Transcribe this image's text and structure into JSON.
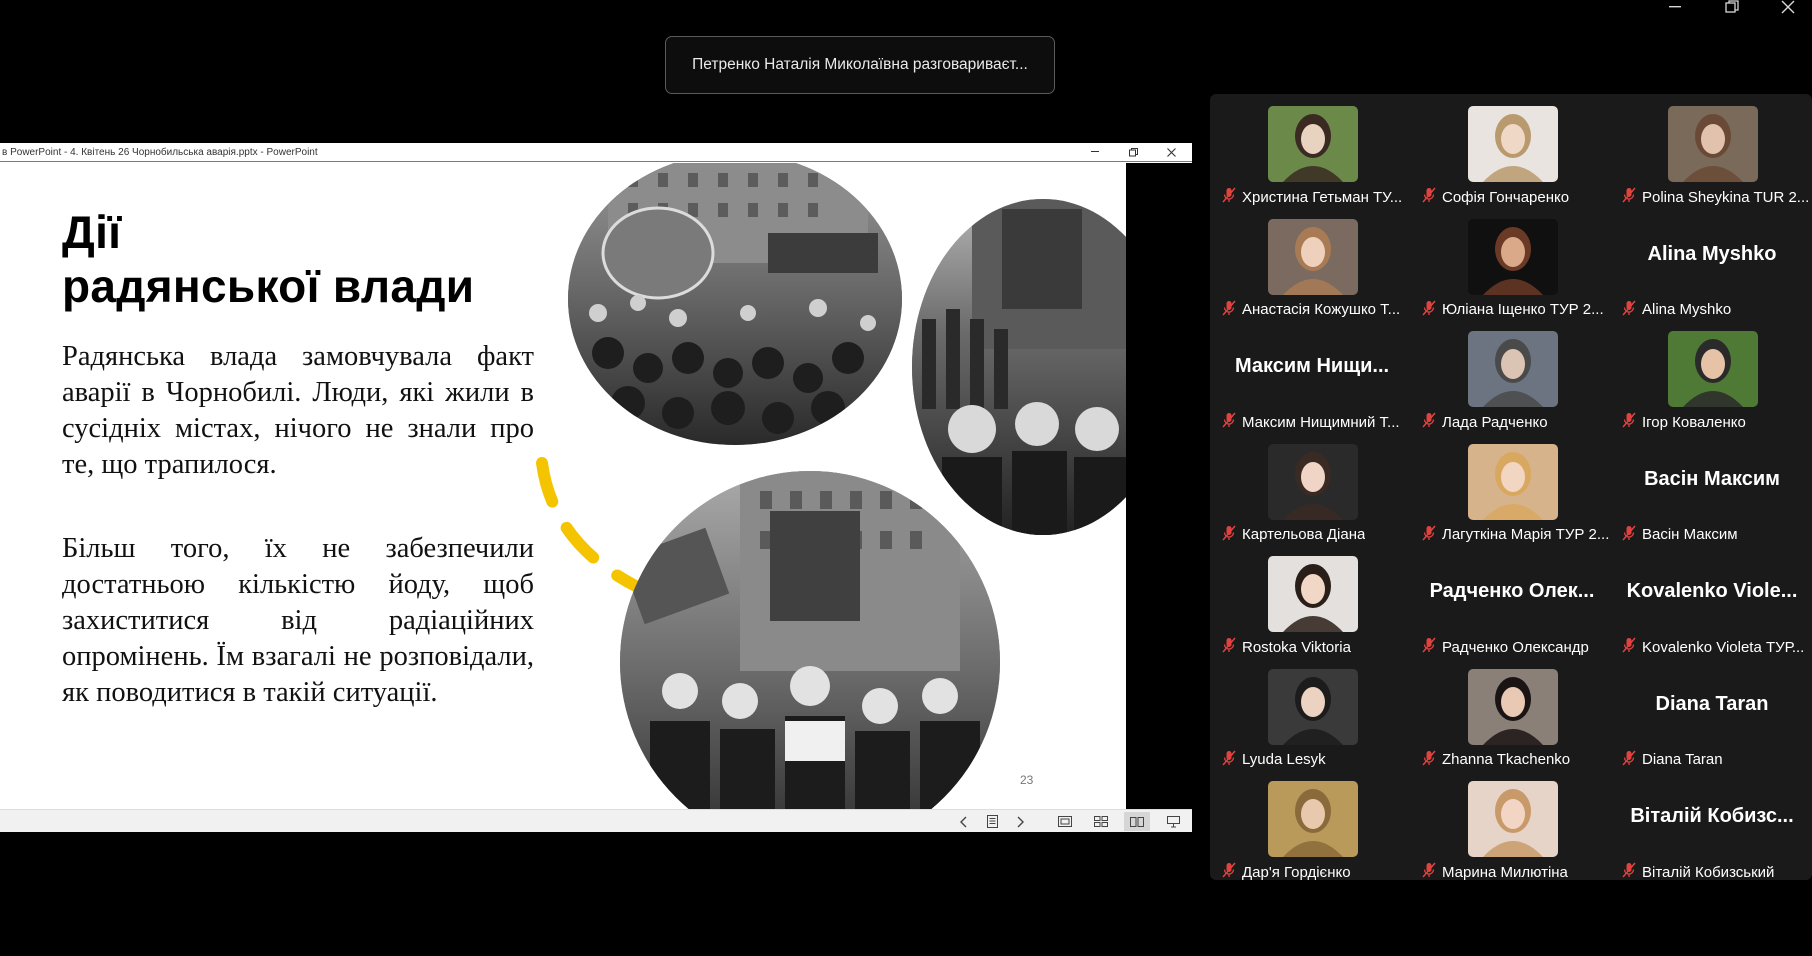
{
  "speaking_toast": "Петренко Наталія Миколаївна разговариваєт...",
  "powerpoint": {
    "window_title": "в PowerPoint  -  4. Квітень 26 Чорнобильська аварія.pptx - PowerPoint"
  },
  "slide": {
    "title_line1": "Дії",
    "title_line2": "радянської влади",
    "paragraph1": "Радянська влада замовчувала факт аварії в Чорнобилі. Люди, які жили в сусідніх містах, нічого не знали про те, що трапилося.",
    "paragraph2": "Більш того, їх не забезпечили достатньою кількістю йоду, щоб захиститися від радіаційних опромінень. Їм взагалі не розповідали, як поводитися в такій ситуації.",
    "page_number": "23",
    "accent_color": "#f5c400"
  },
  "participants": [
    {
      "name": "Христина Гетьман ТУ...",
      "has_video": true,
      "big_name": ""
    },
    {
      "name": "Софія Гончаренко",
      "has_video": true,
      "big_name": ""
    },
    {
      "name": "Polina Sheykina TUR 2...",
      "has_video": true,
      "big_name": ""
    },
    {
      "name": "Анастасія Кожушко Т...",
      "has_video": true,
      "big_name": ""
    },
    {
      "name": "Юліана Іщенко ТУР 2...",
      "has_video": true,
      "big_name": ""
    },
    {
      "name": "Alina Myshko",
      "has_video": false,
      "big_name": "Alina Myshko"
    },
    {
      "name": "Максим Нищимний Т...",
      "has_video": false,
      "big_name": "Максим Нищи..."
    },
    {
      "name": "Лада Радченко",
      "has_video": true,
      "big_name": ""
    },
    {
      "name": "Ігор Коваленко",
      "has_video": true,
      "big_name": ""
    },
    {
      "name": "Картельова Діана",
      "has_video": true,
      "big_name": ""
    },
    {
      "name": "Лагуткіна Марія ТУР 2...",
      "has_video": true,
      "big_name": ""
    },
    {
      "name": "Васін Максим",
      "has_video": false,
      "big_name": "Васін Максим"
    },
    {
      "name": "Rostoka Viktoria",
      "has_video": true,
      "big_name": ""
    },
    {
      "name": "Радченко Олександр",
      "has_video": false,
      "big_name": "Радченко Олек..."
    },
    {
      "name": "Kovalenko Violeta ТУР...",
      "has_video": false,
      "big_name": "Kovalenko Viole..."
    },
    {
      "name": "Lyuda Lesyk",
      "has_video": true,
      "big_name": ""
    },
    {
      "name": "Zhanna Tkachenko",
      "has_video": true,
      "big_name": ""
    },
    {
      "name": "Diana Taran",
      "has_video": false,
      "big_name": "Diana Taran"
    },
    {
      "name": "Дар'я Гордієнко",
      "has_video": true,
      "big_name": ""
    },
    {
      "name": "Марина Милютіна",
      "has_video": true,
      "big_name": ""
    },
    {
      "name": "Віталій Кобизський",
      "has_video": false,
      "big_name": "Віталій Кобизс..."
    }
  ],
  "colors": {
    "gallery_bg": "#1a1a1a",
    "muted_icon": "#e0433f"
  }
}
